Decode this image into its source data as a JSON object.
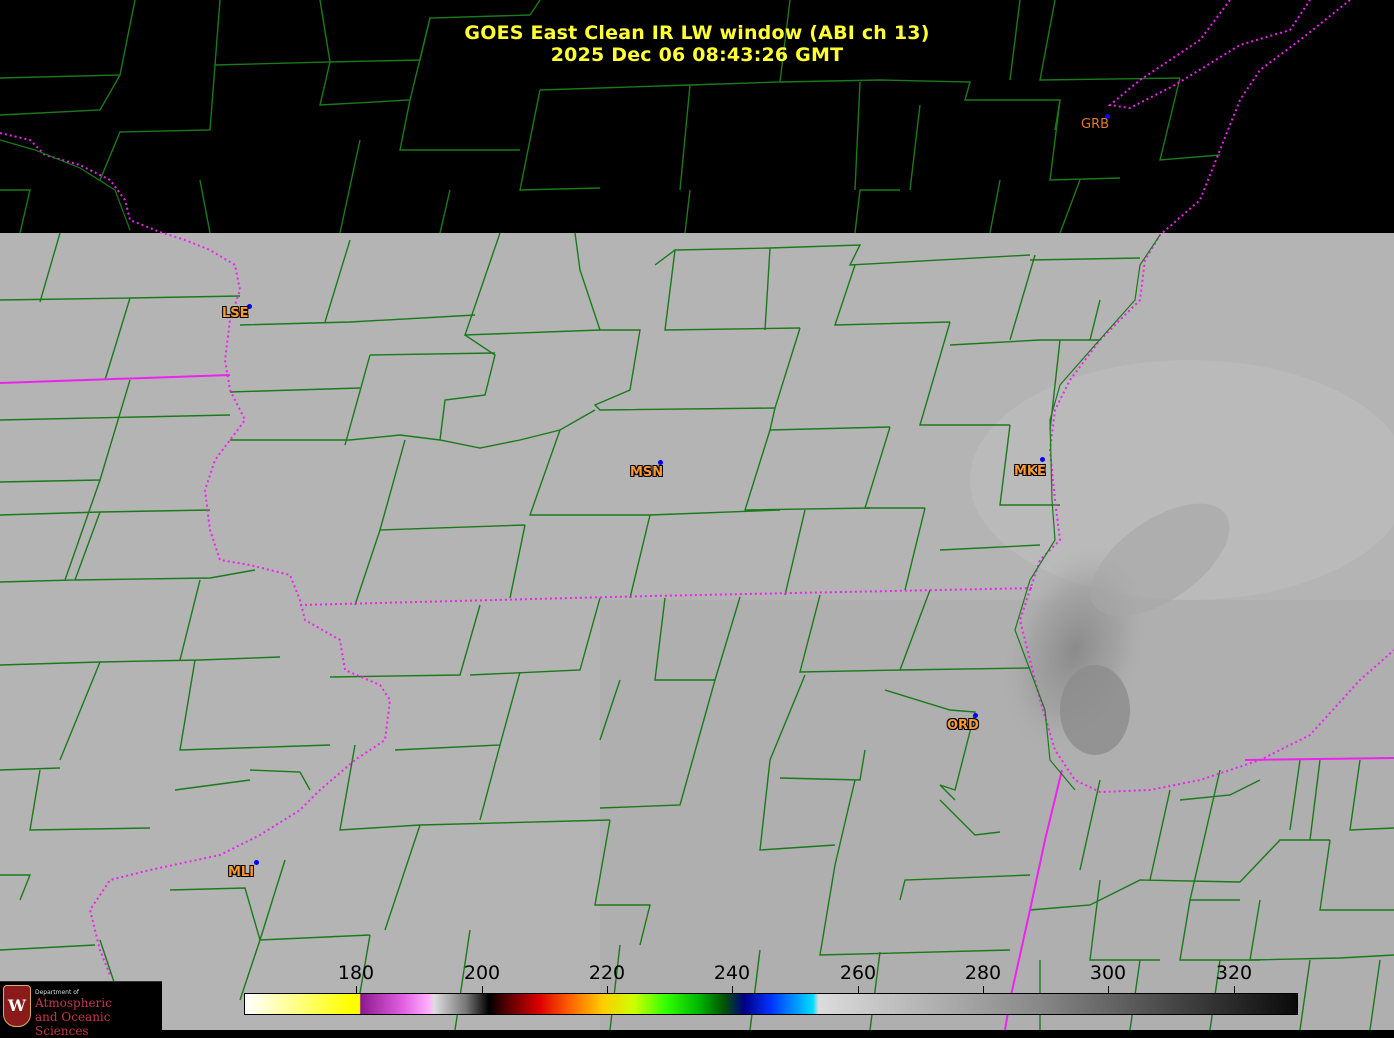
{
  "title": {
    "line1": "GOES East Clean IR LW window (ABI ch 13)",
    "line2": "2025 Dec 06  08:43:26 GMT"
  },
  "stations": [
    {
      "code": "GRB",
      "name": "station-grb"
    },
    {
      "code": "LSE",
      "name": "station-lse"
    },
    {
      "code": "MSN",
      "name": "station-msn"
    },
    {
      "code": "MKE",
      "name": "station-mke"
    },
    {
      "code": "ORD",
      "name": "station-ord"
    },
    {
      "code": "MLI",
      "name": "station-mli"
    }
  ],
  "colorbar": {
    "ticks": [
      "180",
      "200",
      "220",
      "240",
      "260",
      "280",
      "300",
      "320"
    ]
  },
  "logo": {
    "shield_letter": "W",
    "dept": "Department of",
    "line1": "Atmospheric",
    "line2": "and Oceanic Sciences"
  },
  "colors": {
    "title": "#ffff33",
    "station_label": "#ff9933",
    "station_dot": "#0000ff",
    "county_lines": "#1a7a1a",
    "state_lines": "#ee22ee",
    "cloud_gray": "#b4b4b4"
  }
}
